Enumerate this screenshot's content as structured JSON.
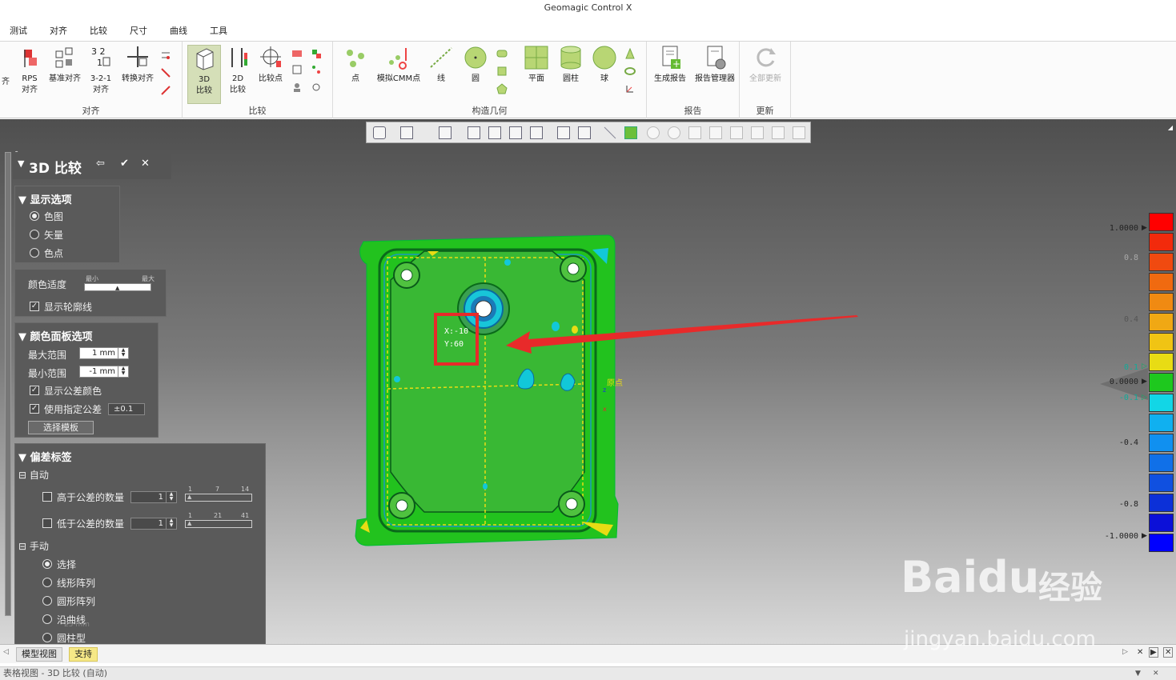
{
  "window": {
    "title": "Geomagic Control X"
  },
  "menu": [
    "测试",
    "对齐",
    "比较",
    "尺寸",
    "曲线",
    "工具"
  ],
  "ribbon": {
    "groups": [
      {
        "label": "对齐"
      },
      {
        "label": "比较"
      },
      {
        "label": "构造几何"
      },
      {
        "label": "报告"
      },
      {
        "label": "更新"
      }
    ],
    "align_buttons": [
      {
        "label": "齐"
      },
      {
        "label": "RPS",
        "sub": "对齐"
      },
      {
        "label": "基准对齐"
      },
      {
        "label": "3-2-1",
        "sub": "对齐"
      },
      {
        "label": "转换对齐"
      }
    ],
    "compare_buttons": [
      {
        "label": "3D",
        "sub": "比较"
      },
      {
        "label": "2D",
        "sub": "比较"
      },
      {
        "label": "比较点"
      }
    ],
    "geometry_buttons": [
      {
        "label": "点"
      },
      {
        "label": "模拟CMM点"
      },
      {
        "label": "线"
      },
      {
        "label": "圆"
      },
      {
        "label": "平面"
      },
      {
        "label": "圆柱"
      },
      {
        "label": "球"
      }
    ],
    "report_buttons": [
      {
        "label": "生成报告"
      },
      {
        "label": "报告管理器"
      }
    ],
    "update_buttons": [
      {
        "label": "全部更新"
      }
    ]
  },
  "panel": {
    "title": "3D 比较",
    "display_options": {
      "title": "显示选项",
      "options": [
        "色图",
        "矢量",
        "色点"
      ],
      "selected": 0
    },
    "color_fit": {
      "label": "颜色适度",
      "min_label": "最小",
      "max_label": "最大",
      "level": 0.5,
      "show_contour": "显示轮廓线",
      "show_contour_checked": true
    },
    "color_panel": {
      "title": "颜色面板选项",
      "max_label": "最大范围",
      "max_value": "1 mm",
      "min_label": "最小范围",
      "min_value": "-1 mm",
      "show_tol_color": "显示公差颜色",
      "show_tol_checked": true,
      "use_tol": "使用指定公差",
      "use_tol_checked": true,
      "tol_value": "±0.1",
      "template_btn": "选择模板"
    },
    "deviation_labels": {
      "title": "偏差标签",
      "auto": "自动",
      "above": "高于公差的数量",
      "above_value": "1",
      "above_ticks": [
        "1",
        "7",
        "14"
      ],
      "below": "低于公差的数量",
      "below_value": "1",
      "below_ticks": [
        "1",
        "21",
        "41"
      ],
      "manual": "手动",
      "manual_options": [
        "选择",
        "线形阵列",
        "圆形阵列",
        "沿曲线",
        "圆柱型"
      ],
      "manual_selected": 0
    }
  },
  "annotation": {
    "x": "X:-10",
    "y": "Y:60",
    "origin_label": "原点"
  },
  "scale_hint": "25 mm",
  "colorbar": {
    "labels": [
      "1.0000",
      "0.8",
      "0.4",
      "0.1",
      "0.0000",
      "-0.1",
      "-0.4",
      "-0.8",
      "-1.0000"
    ],
    "colors": [
      "#ff0000",
      "#f22a0c",
      "#f04a10",
      "#f06a10",
      "#f08a12",
      "#f0a814",
      "#f0c414",
      "#e8dc14",
      "#1ec81e",
      "#12d6e6",
      "#10b0f0",
      "#1090f0",
      "#1070e8",
      "#1050e0",
      "#0c30d8",
      "#0c10d8",
      "#0000ff"
    ]
  },
  "tabs": [
    "模型视图",
    "支持"
  ],
  "status": "表格视图 - 3D 比较 (自动)",
  "watermark": {
    "brand": "Baidu",
    "cn": "经验",
    "url": "jingyan.baidu.com"
  },
  "colors": {
    "accent": "#d5dfb8",
    "panel": "#5a5a5a",
    "deviation_green": "#1ec81e",
    "highlight_red": "#e82a2a"
  }
}
